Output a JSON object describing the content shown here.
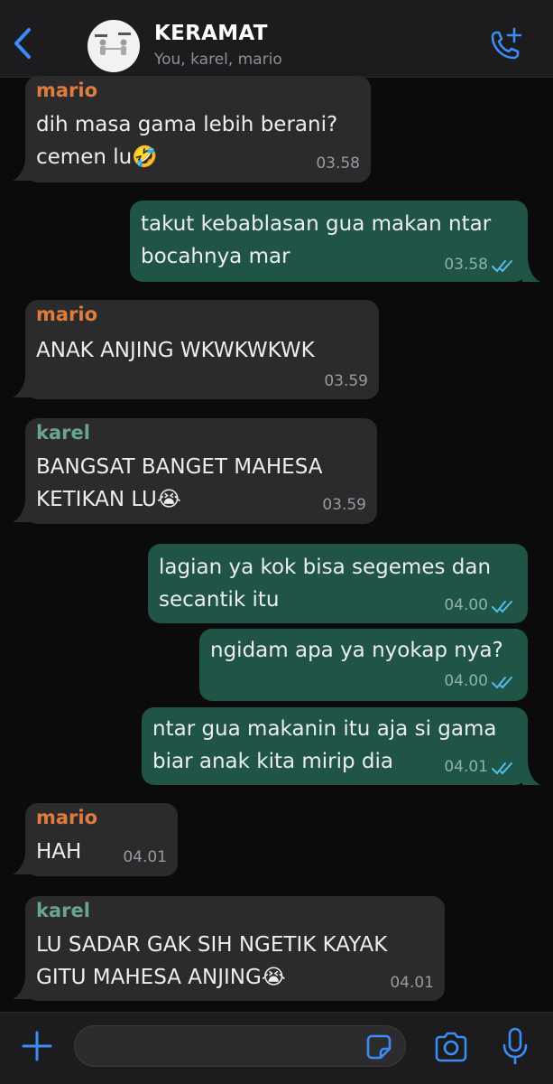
{
  "header": {
    "group_name": "KERAMAT",
    "members": "You, karel, mario"
  },
  "colors": {
    "accent": "#3b8cf5",
    "outgoing_bubble": "#1f5446",
    "incoming_bubble": "#2b2b2d",
    "mario_name": "#e07c3e",
    "karel_name": "#6aa594",
    "read_ticks": "#53bdeb"
  },
  "messages": [
    {
      "sender": "mario",
      "line1": "dih masa gama lebih berani?",
      "line2": "cemen lu🤣",
      "time": "03.58"
    },
    {
      "sender": "You",
      "line1": "takut kebablasan gua makan ntar",
      "line2": "bocahnya mar",
      "time": "03.58",
      "status": "read"
    },
    {
      "sender": "mario",
      "line1": "ANAK ANJING WKWKWKWK",
      "time": "03.59"
    },
    {
      "sender": "karel",
      "line1": "BANGSAT BANGET MAHESA",
      "line2": "KETIKAN LU😭",
      "time": "03.59"
    },
    {
      "sender": "You",
      "line1": "lagian ya kok bisa segemes dan",
      "line2": "secantik itu",
      "time": "04.00",
      "status": "read"
    },
    {
      "sender": "You",
      "line1": "ngidam apa ya nyokap nya?",
      "time": "04.00",
      "status": "read"
    },
    {
      "sender": "You",
      "line1": "ntar gua makanin itu aja si gama",
      "line2": "biar anak kita mirip dia",
      "time": "04.01",
      "status": "read"
    },
    {
      "sender": "mario",
      "line1": "HAH",
      "time": "04.01"
    },
    {
      "sender": "karel",
      "line1": "LU SADAR GAK SIH NGETIK KAYAK",
      "line2": "GITU MAHESA ANJING😭",
      "time": "04.01"
    }
  ],
  "composer": {
    "icons": [
      "plus-icon",
      "sticker-icon",
      "camera-icon",
      "microphone-icon"
    ]
  }
}
